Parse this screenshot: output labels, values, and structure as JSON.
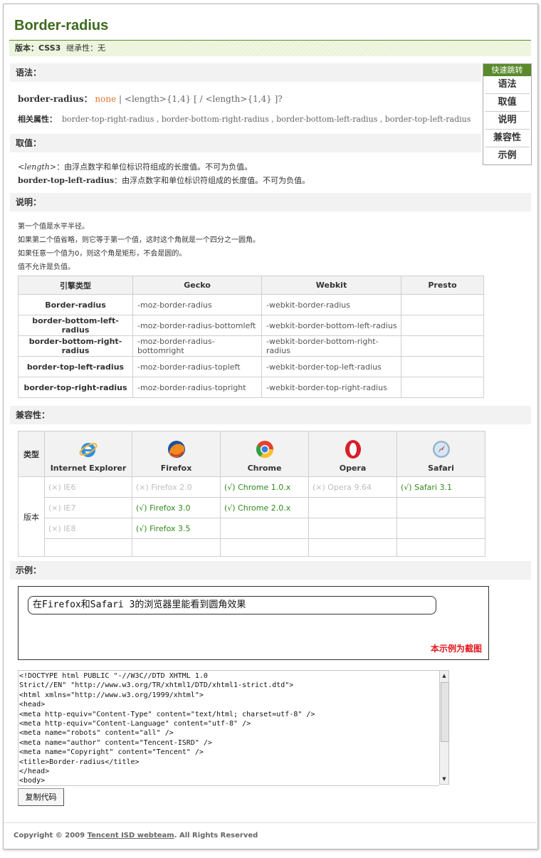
{
  "page": {
    "title": "Border-radius"
  },
  "version_bar": {
    "version_label": "版本：",
    "version": "CSS3",
    "inherit_label": "继承性：",
    "inherit": "无"
  },
  "sections": {
    "syntax": "语法：",
    "values": "取值：",
    "desc": "说明：",
    "compat": "兼容性：",
    "example": "示例："
  },
  "quick_nav": {
    "header": "快速跳转",
    "items": [
      "语法",
      "取值",
      "说明",
      "兼容性",
      "示例"
    ]
  },
  "syntax": {
    "prop": "border-radius：",
    "none": "none",
    "sep": "|",
    "rest": "<length>{1,4} [ / <length>{1,4} ]?",
    "related_label": "相关属性：",
    "related": "border-top-right-radius , border-bottom-right-radius , border-bottom-left-radius , border-top-left-radius"
  },
  "values": {
    "v1_key": "<length>",
    "v1_text": "：由浮点数字和单位标识符组成的长度值。不可为负值。",
    "v2_key": "border-top-left-radius",
    "v2_text": "：由浮点数字和单位标识符组成的长度值。不可为负值。"
  },
  "description": [
    "第一个值是水平半径。",
    "如果第二个值省略，则它等于第一个值，这时这个角就是一个四分之一圆角。",
    "如果任意一个值为0，则这个角是矩形，不会是圆的。",
    "值不允许是负值。"
  ],
  "engine_table": {
    "headers": [
      "引擎类型",
      "Gecko",
      "Webkit",
      "Presto"
    ],
    "rows": [
      [
        "Border-radius",
        "-moz-border-radius",
        "-webkit-border-radius",
        ""
      ],
      [
        "border-bottom-left-radius",
        "-moz-border-radius-bottomleft",
        "-webkit-border-bottom-left-radius",
        ""
      ],
      [
        "border-bottom-right-radius",
        "-moz-border-radius-bottomright",
        "-webkit-border-bottom-right-radius",
        ""
      ],
      [
        "border-top-left-radius",
        "-moz-border-radius-topleft",
        "-webkit-border-top-left-radius",
        ""
      ],
      [
        "border-top-right-radius",
        "-moz-border-radius-topright",
        "-webkit-border-top-right-radius",
        ""
      ]
    ]
  },
  "compat_table": {
    "type_label": "类型",
    "version_label": "版本",
    "browsers": [
      {
        "name": "Internet Explorer",
        "icon": "ie-icon"
      },
      {
        "name": "Firefox",
        "icon": "firefox-icon"
      },
      {
        "name": "Chrome",
        "icon": "chrome-icon"
      },
      {
        "name": "Opera",
        "icon": "opera-icon"
      },
      {
        "name": "Safari",
        "icon": "safari-icon"
      }
    ],
    "rows": [
      [
        "(×) IE6",
        "(×) Firefox 2.0",
        "(√) Chrome 1.0.x",
        "(×) Opera 9.64",
        "(√) Safari 3.1"
      ],
      [
        "(×) IE7",
        "(√) Firefox 3.0",
        "(√) Chrome 2.0.x",
        "",
        ""
      ],
      [
        "(×) IE8",
        "(√) Firefox 3.5",
        "",
        "",
        ""
      ],
      [
        "",
        "",
        "",
        "",
        ""
      ]
    ]
  },
  "example": {
    "demo_text": "在Firefox和Safari 3的浏览器里能看到圆角效果",
    "note": "本示例为截图",
    "code": "<!DOCTYPE html PUBLIC \"-//W3C//DTD XHTML 1.0\nStrict//EN\" \"http://www.w3.org/TR/xhtml1/DTD/xhtml1-strict.dtd\">\n<html xmlns=\"http://www.w3.org/1999/xhtml\">\n<head>\n<meta http-equiv=\"Content-Type\" content=\"text/html; charset=utf-8\" />\n<meta http-equiv=\"Content-Language\" content=\"utf-8\" />\n<meta name=\"robots\" content=\"all\" />\n<meta name=\"author\" content=\"Tencent-ISRD\" />\n<meta name=\"Copyright\" content=\"Tencent\" />\n<title>Border-radius</title>\n</head>\n<body>",
    "copy_button": "复制代码"
  },
  "footer": {
    "prefix": "Copyright © 2009 ",
    "link": "Tencent ISD webteam",
    "suffix": ". All Rights Reserved"
  },
  "colors": {
    "brand_green": "#3d6b1c",
    "accent_orange": "#e6732a",
    "ok_green": "#2f8a1b",
    "note_red": "#e1191e"
  }
}
